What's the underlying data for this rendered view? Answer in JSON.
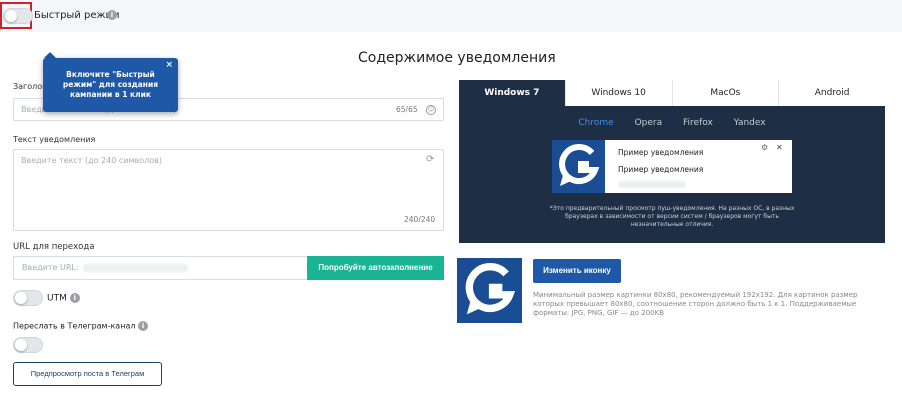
{
  "fast_mode": {
    "label": "Быстрый режим",
    "tooltip": "Включите \"Быстрый режим\" для создания кампании в 1 клик",
    "tooltip_close": "×"
  },
  "page": {
    "title": "Содержимое уведомления"
  },
  "form": {
    "title_label": "Заголовок уведомления",
    "title_placeholder": "Введите заголовок (до 65 символов)",
    "title_counter": "65/65",
    "text_label": "Текст уведомления",
    "text_placeholder": "Введите текст (до 240 символов)",
    "text_counter": "240/240",
    "url_label": "URL для перехода",
    "url_placeholder": "Введите URL:",
    "autofill_button": "Попробуйте автозаполнение",
    "utm_label": "UTM",
    "telegram_label": "Переслать в Телеграм-канал",
    "telegram_preview_button": "Предпросмотр поста в Телеграм"
  },
  "preview": {
    "os_tabs": [
      "Windows 7",
      "Windows 10",
      "MacOs",
      "Android"
    ],
    "active_os": 0,
    "browser_tabs": [
      "Chrome",
      "Opera",
      "Firefox",
      "Yandex"
    ],
    "active_browser": 0,
    "notification_title": "Пример уведомления",
    "notification_text": "Пример уведомления",
    "note": "*Это предварительный просмотр пуш-уведомления. На разных ОС, в разных браузерах в зависимости от версии систем / браузеров могут быть незначительные отличия."
  },
  "icon": {
    "change_button": "Изменить иконку",
    "hint": "Минимальный размер картинки 80х80, рекомендуемый 192х192. Для картинок размер которых превышает 80х80, соотношение сторон должно быть 1 к 1. Поддерживаемые форматы: JPG, PNG, GIF — до 200KB"
  },
  "colors": {
    "primary": "#1e58a6",
    "preview_bg": "#1e2e45",
    "autofill": "#1ab394",
    "highlight": "#c9252c"
  }
}
